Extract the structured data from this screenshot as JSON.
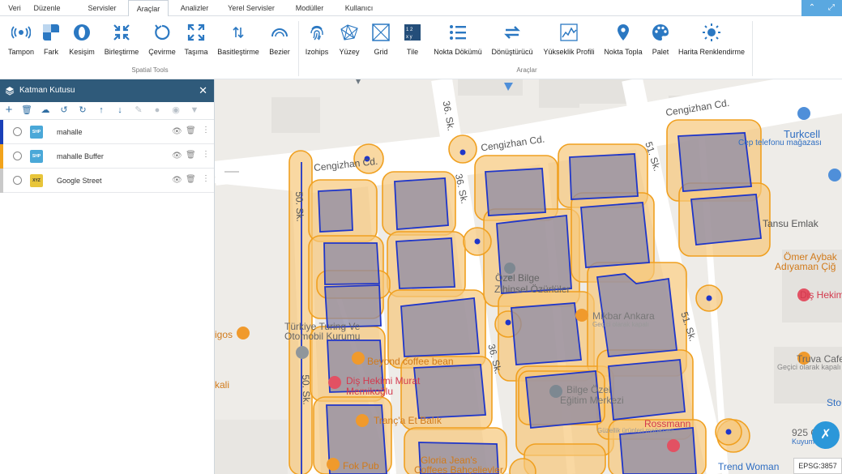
{
  "menu": {
    "tabs": [
      "Veri",
      "Düzenle",
      "Servisler",
      "Araçlar",
      "Analizler",
      "Yerel Servisler",
      "Modüller",
      "Kullanıcı"
    ],
    "active": "Araçlar"
  },
  "ribbon": {
    "spatial_tools": [
      "Tampon",
      "Fark",
      "Kesişim",
      "Birleştirme",
      "Çevirme",
      "Taşıma",
      "Basitleştirme",
      "Bezier"
    ],
    "spatial_group_label": "Spatial Tools",
    "tools": [
      "Izohips",
      "Yüzey",
      "Grid",
      "Tile",
      "Nokta Dökümü",
      "Dönüştürücü",
      "Yükseklik Profili",
      "Nokta Topla",
      "Palet",
      "Harita Renklendirme"
    ],
    "tools_group_label": "Araçlar"
  },
  "layer_panel": {
    "title": "Katman Kutusu",
    "layers": [
      {
        "name": "mahalle",
        "color": "#1a3fb8",
        "icon_text": "SHP"
      },
      {
        "name": "mahalle Buffer",
        "color": "#f2a31b",
        "icon_text": "SHP"
      },
      {
        "name": "Google Street",
        "color": "#c9c9c9",
        "icon_text": "XYZ"
      }
    ]
  },
  "map": {
    "streets": [
      "Cengizhan Cd.",
      "Cengizhan Cd.",
      "Cengizhan Cd.",
      "36. Sk.",
      "36. Sk.",
      "36. Sk.",
      "50. Sk.",
      "50. Sk.",
      "51. Sk.",
      "51. Sk."
    ],
    "pois": [
      "Turkcell",
      "Cep telefonu mağazası",
      "Tansu Emlak",
      "Ömer Aybak",
      "Adıyaman Çiğ",
      "Diş Hekim",
      "Özel Bilge",
      "Zihinsel Özürlüler",
      "Türkiye Turing Ve",
      "Otomobil Kurumu",
      "Beyond coffee bean",
      "Diş Hekimi Murat",
      "Memikoğlu",
      "Tranç'a Et Balık",
      "Fok Pub",
      "Gloria Jean's",
      "Coffees Bahçelievler",
      "Mikbar Ankara",
      "Geçici olarak kapalı",
      "Bilge Özel",
      "Eğitim Merkezi",
      "Rossmann",
      "Güzellik ürünleri mağazası",
      "Truva Cafe",
      "Geçici olarak kapalı",
      "Trend Woman",
      "igos",
      "kali",
      "Sto",
      "925 G",
      "Kuyumcu"
    ]
  },
  "epsg": "EPSG:3857"
}
